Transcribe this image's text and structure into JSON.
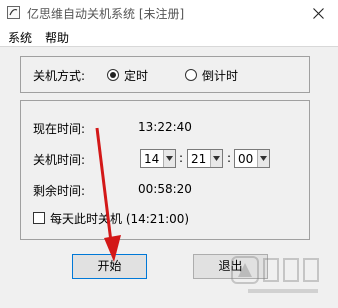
{
  "window": {
    "title": "亿思维自动关机系统 [未注册]",
    "close_icon": "close-icon",
    "app_icon": "app-icon"
  },
  "menu": {
    "items": [
      {
        "label": "系统"
      },
      {
        "label": "帮助"
      }
    ]
  },
  "mode": {
    "label": "关机方式:",
    "options": [
      {
        "label": "定时",
        "selected": true
      },
      {
        "label": "倒计时",
        "selected": false
      }
    ]
  },
  "time": {
    "current_label": "现在时间:",
    "current_value": "13:22:40",
    "shutdown_label": "关机时间:",
    "hour": "14",
    "minute": "21",
    "second": "00",
    "sep": ":",
    "remaining_label": "剩余时间:",
    "remaining_value": "00:58:20"
  },
  "daily": {
    "label": "每天此时关机 (14:21:00)",
    "checked": false
  },
  "buttons": {
    "start": "开始",
    "exit": "退出"
  },
  "colors": {
    "accent": "#0078d7",
    "annotation_arrow": "#d31818"
  }
}
